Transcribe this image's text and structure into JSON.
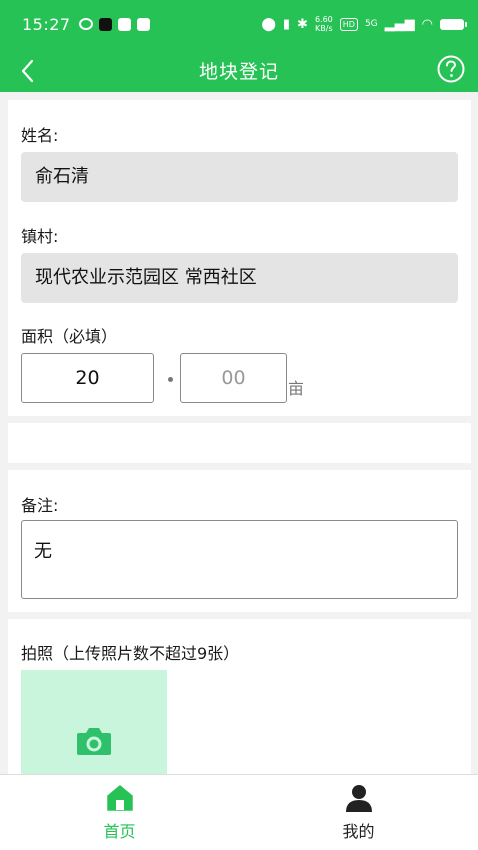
{
  "status_bar": {
    "time": "15:27",
    "speed_value": "6.60",
    "speed_unit": "KB/s",
    "hd_badge": "HD",
    "network": "5G"
  },
  "header": {
    "title": "地块登记"
  },
  "form": {
    "name_label": "姓名:",
    "name_value": "俞石清",
    "village_label": "镇村:",
    "village_value": "现代农业示范园区 常西社区",
    "area_label": "面积（必填）",
    "area_integer": "20",
    "area_decimal_placeholder": "00",
    "area_unit": "亩",
    "remark_label": "备注:",
    "remark_value": "无",
    "photo_label": "拍照（上传照片数不超过9张）"
  },
  "bottom_nav": {
    "items": [
      {
        "label": "首页",
        "active": true
      },
      {
        "label": "我的",
        "active": false
      }
    ]
  },
  "colors": {
    "primary": "#26c255",
    "photo_tile": "#c8f5dc",
    "readonly_bg": "#e4e4e4"
  }
}
